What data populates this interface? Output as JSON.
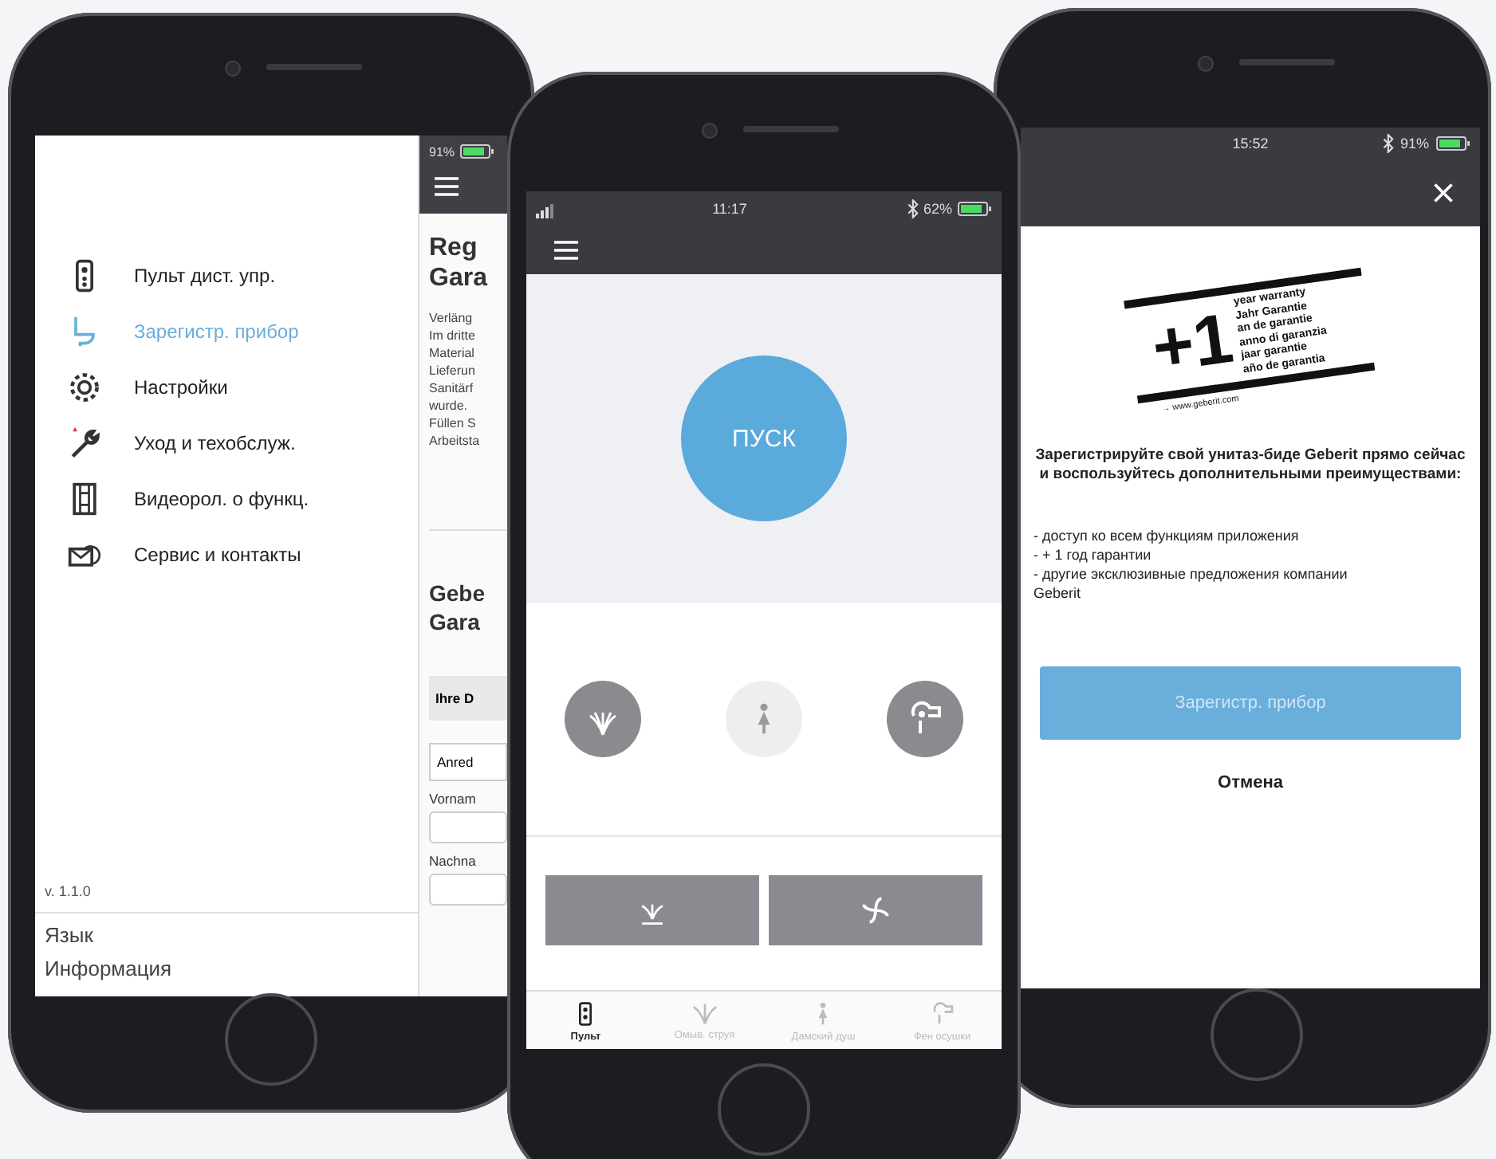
{
  "left_phone": {
    "status": {
      "battery": "91%"
    },
    "menu": {
      "items": [
        {
          "label": "Пульт дист. упр.",
          "selected": false
        },
        {
          "label": "Зарегистр. прибор",
          "selected": true
        },
        {
          "label": "Настройки",
          "selected": false
        },
        {
          "label": "Уход и техобслуж.",
          "selected": false
        },
        {
          "label": "Видеорол. о функц.",
          "selected": false
        },
        {
          "label": "Сервис и контакты",
          "selected": false
        }
      ],
      "version": "v. 1.1.0",
      "footer_links": [
        "Язык",
        "Информация"
      ]
    },
    "page": {
      "title_lines": [
        "Reg",
        "Gara"
      ],
      "body_lines": [
        "Verläng",
        "Im dritte",
        "Material",
        "Lieferun",
        "Sanitärf",
        "wurde.",
        "Füllen S",
        "Arbeitsta"
      ],
      "subtitle_lines": [
        "Gebe",
        "Gara"
      ],
      "section": "Ihre D",
      "select": "Anred",
      "fields": [
        {
          "label": "Vornam"
        },
        {
          "label": "Nachna"
        }
      ]
    }
  },
  "middle_phone": {
    "status": {
      "time": "11:17",
      "battery": "62%"
    },
    "start_button": "ПУСК",
    "modes": [
      {
        "enabled": true
      },
      {
        "enabled": false
      },
      {
        "enabled": true
      }
    ],
    "tabs": [
      {
        "label": "Пульт",
        "selected": true
      },
      {
        "label": "Омыв. струя",
        "selected": false
      },
      {
        "label": "Дамский душ",
        "selected": false
      },
      {
        "label": "Фен осушки",
        "selected": false
      }
    ]
  },
  "right_phone": {
    "status": {
      "time": "15:52",
      "battery": "91%"
    },
    "warranty_logo": {
      "number": "+1",
      "lines": [
        "year warranty",
        "Jahr Garantie",
        "an de garantie",
        "anno di garanzia",
        "jaar garantie",
        "año de garantia"
      ],
      "url": "→ www.geberit.com"
    },
    "heading": "Зарегистрируйте свой унитаз-биде Geberit прямо сейчас и воспользуйтесь дополнительными преимуществами:",
    "bullets": [
      "- доступ ко всем функциям приложения",
      "- + 1 год гарантии",
      "- другие эксклюзивные предложения компании Geberit"
    ],
    "register_button": "Зарегистр. прибор",
    "cancel_button": "Отмена"
  }
}
